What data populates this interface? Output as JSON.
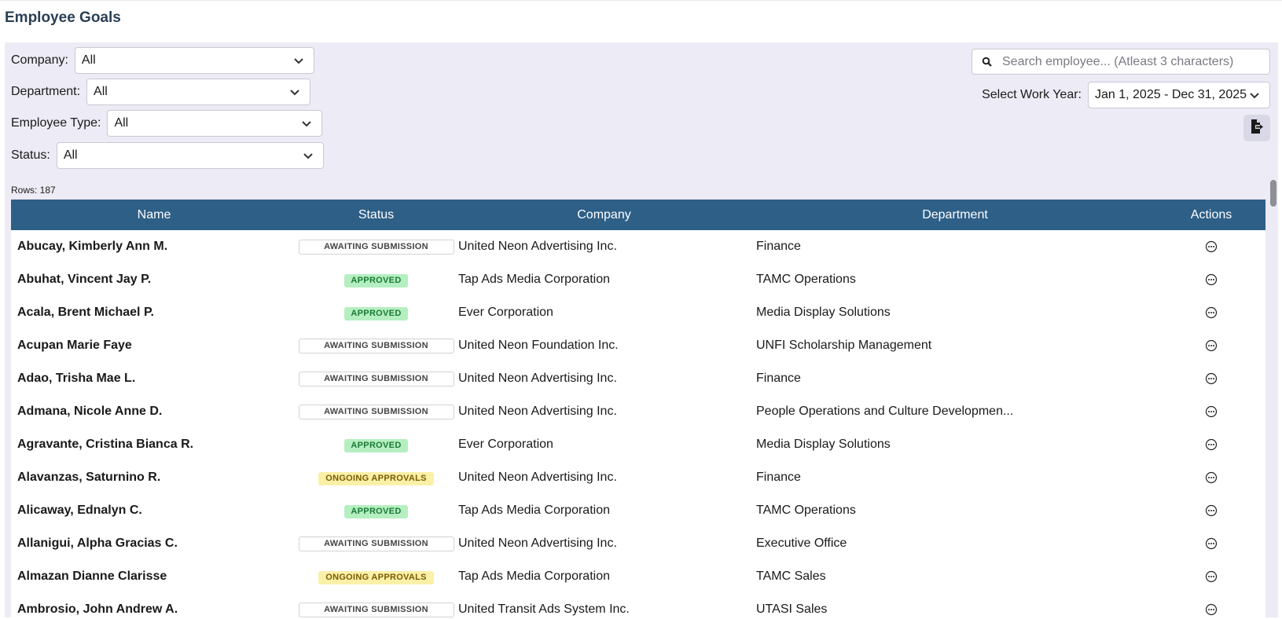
{
  "page": {
    "title": "Employee Goals"
  },
  "filters": {
    "company": {
      "label": "Company:",
      "value": "All"
    },
    "department": {
      "label": "Department:",
      "value": "All"
    },
    "employee_type": {
      "label": "Employee Type:",
      "value": "All"
    },
    "status": {
      "label": "Status:",
      "value": "All"
    }
  },
  "search": {
    "placeholder": "Search employee... (Atleast 3 characters)",
    "icon": "search-icon"
  },
  "work_year": {
    "label": "Select Work Year:",
    "value": "Jan 1, 2025 - Dec 31, 2025"
  },
  "export": {
    "icon": "export-file-icon"
  },
  "table": {
    "rows_label": "Rows: 187",
    "columns": [
      "Name",
      "Status",
      "Company",
      "Department",
      "Actions"
    ],
    "rows": [
      {
        "name": "Abucay, Kimberly Ann M.",
        "status": "AWAITING SUBMISSION",
        "status_type": "awaiting",
        "company": "United Neon Advertising Inc.",
        "department": "Finance"
      },
      {
        "name": "Abuhat, Vincent Jay P.",
        "status": "APPROVED",
        "status_type": "approved",
        "company": "Tap Ads Media Corporation",
        "department": "TAMC Operations"
      },
      {
        "name": "Acala, Brent Michael P.",
        "status": "APPROVED",
        "status_type": "approved",
        "company": "Ever Corporation",
        "department": "Media Display Solutions"
      },
      {
        "name": "Acupan Marie Faye",
        "status": "AWAITING SUBMISSION",
        "status_type": "awaiting",
        "company": "United Neon Foundation Inc.",
        "department": "UNFI Scholarship Management"
      },
      {
        "name": "Adao, Trisha Mae L.",
        "status": "AWAITING SUBMISSION",
        "status_type": "awaiting",
        "company": "United Neon Advertising Inc.",
        "department": "Finance"
      },
      {
        "name": "Admana, Nicole Anne D.",
        "status": "AWAITING SUBMISSION",
        "status_type": "awaiting",
        "company": "United Neon Advertising Inc.",
        "department": "People Operations and Culture Developmen..."
      },
      {
        "name": "Agravante, Cristina Bianca R.",
        "status": "APPROVED",
        "status_type": "approved",
        "company": "Ever Corporation",
        "department": "Media Display Solutions"
      },
      {
        "name": "Alavanzas, Saturnino R.",
        "status": "ONGOING APPROVALS",
        "status_type": "ongoing",
        "company": "United Neon Advertising Inc.",
        "department": "Finance"
      },
      {
        "name": "Alicaway, Ednalyn C.",
        "status": "APPROVED",
        "status_type": "approved",
        "company": "Tap Ads Media Corporation",
        "department": "TAMC Operations"
      },
      {
        "name": "Allanigui, Alpha Gracias C.",
        "status": "AWAITING SUBMISSION",
        "status_type": "awaiting",
        "company": "United Neon Advertising Inc.",
        "department": "Executive Office"
      },
      {
        "name": "Almazan Dianne Clarisse",
        "status": "ONGOING APPROVALS",
        "status_type": "ongoing",
        "company": "Tap Ads Media Corporation",
        "department": "TAMC Sales"
      },
      {
        "name": "Ambrosio, John Andrew A.",
        "status": "AWAITING SUBMISSION",
        "status_type": "awaiting",
        "company": "United Transit Ads System Inc.",
        "department": "UTASI Sales"
      }
    ]
  },
  "colors": {
    "header_bg": "#2e5f87",
    "panel_bg": "#edebf5",
    "approved_bg": "#b5efc1",
    "ongoing_bg": "#fbf0a8",
    "title": "#2a3f55"
  }
}
